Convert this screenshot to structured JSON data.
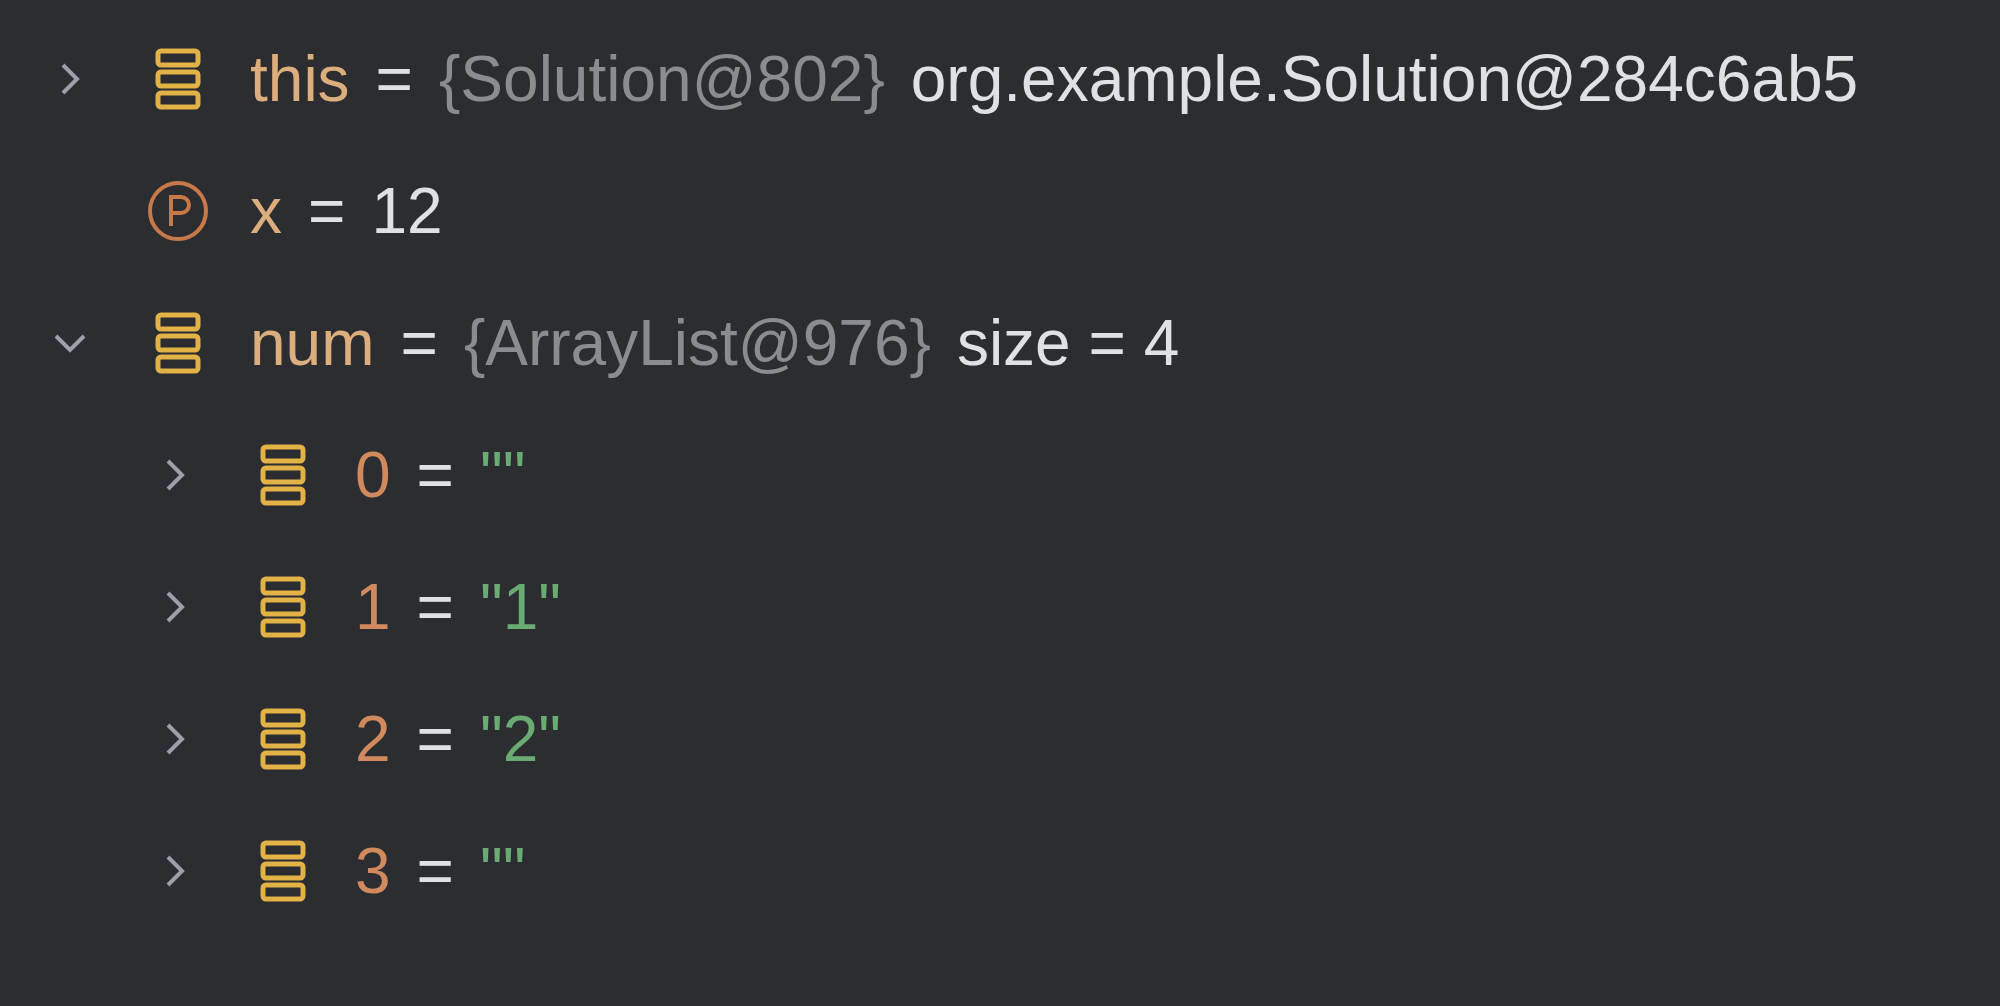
{
  "variables": [
    {
      "kind": "object",
      "name": "this",
      "equals": "=",
      "type": "{Solution@802}",
      "value": "org.example.Solution@284c6ab5",
      "is_string": false,
      "expanded": false
    },
    {
      "kind": "parameter",
      "name": "x",
      "equals": "=",
      "value": "12",
      "is_string": false
    },
    {
      "kind": "object",
      "name": "num",
      "equals": "=",
      "type": "{ArrayList@976}",
      "value": "size = 4",
      "is_string": false,
      "expanded": true,
      "children": [
        {
          "kind": "element",
          "name": "0",
          "equals": "=",
          "value": "\"\"",
          "is_string": true,
          "expanded": false
        },
        {
          "kind": "element",
          "name": "1",
          "equals": "=",
          "value": "\"1\"",
          "is_string": true,
          "expanded": false
        },
        {
          "kind": "element",
          "name": "2",
          "equals": "=",
          "value": "\"2\"",
          "is_string": true,
          "expanded": false
        },
        {
          "kind": "element",
          "name": "3",
          "equals": "=",
          "value": "\"\"",
          "is_string": true,
          "expanded": false
        }
      ]
    }
  ]
}
